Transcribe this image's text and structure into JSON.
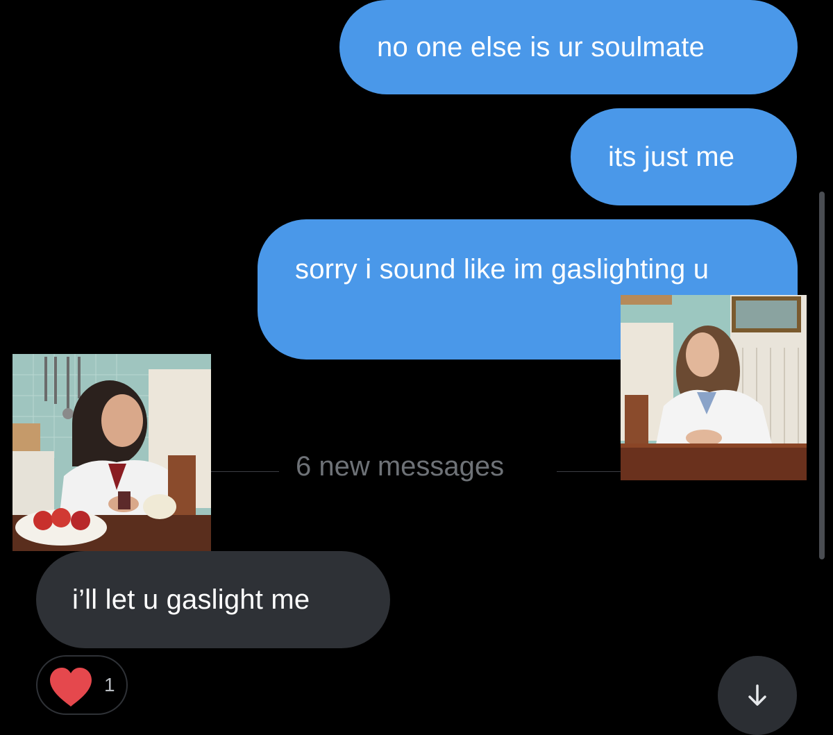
{
  "messages": [
    {
      "id": "msg1",
      "direction": "outgoing",
      "text": "no one else is ur soulmate"
    },
    {
      "id": "msg2",
      "direction": "outgoing",
      "text": "its just me"
    },
    {
      "id": "msg3",
      "direction": "outgoing",
      "text": "sorry i sound like im gaslighting u"
    },
    {
      "id": "msg4",
      "direction": "incoming",
      "text": "i’ll let u gaslight me"
    }
  ],
  "divider": {
    "label": "6 new messages"
  },
  "reaction": {
    "icon": "heart-icon",
    "count": "1",
    "color": "#e5484d"
  },
  "colors": {
    "background": "#000000",
    "outgoing_bubble": "#4a98e9",
    "incoming_bubble": "#2e3136",
    "divider_text": "#6e7277"
  },
  "jump_button": {
    "icon": "arrow-down-icon"
  }
}
